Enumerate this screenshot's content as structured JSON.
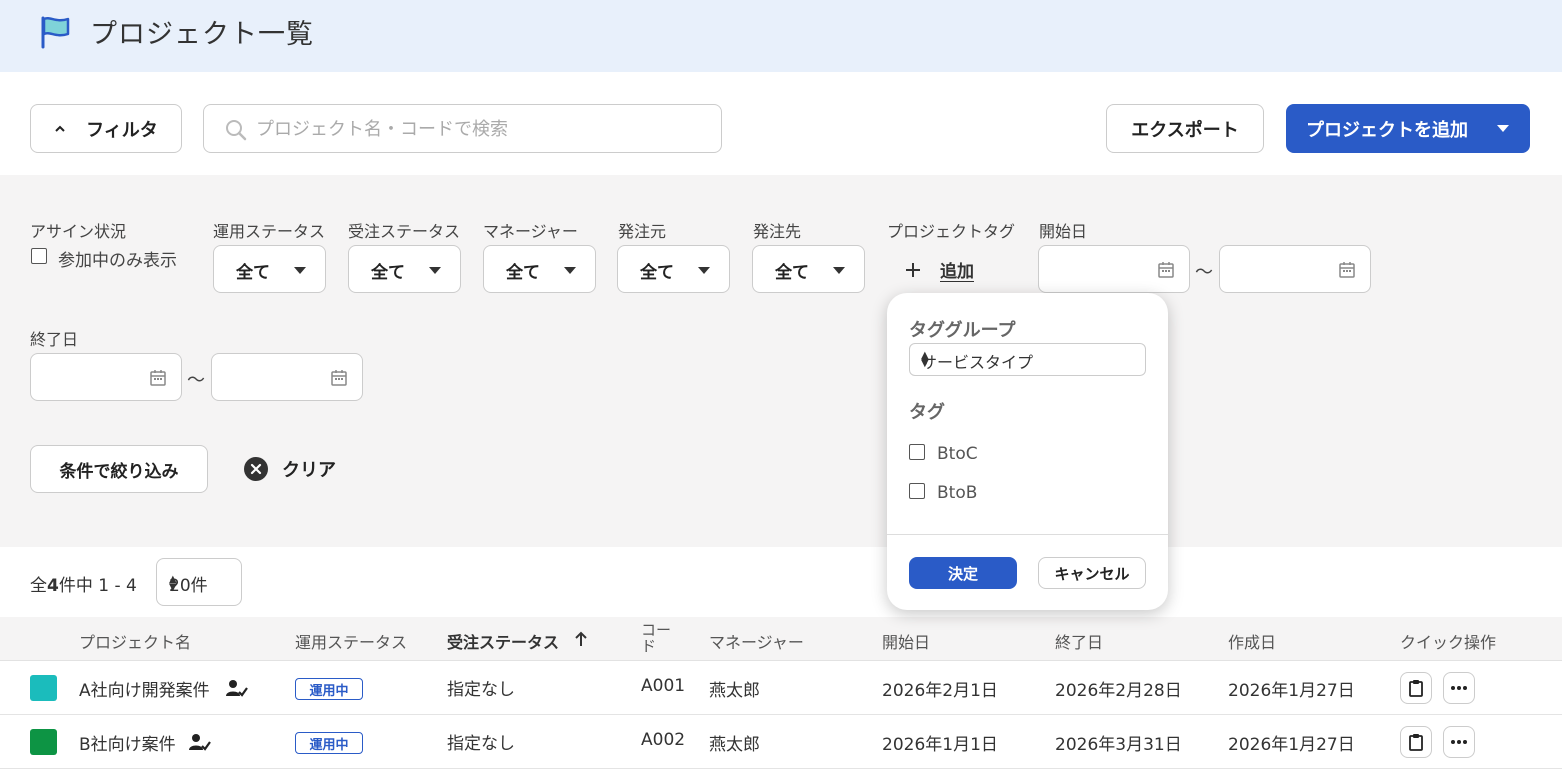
{
  "header": {
    "title": "プロジェクト一覧"
  },
  "toolbar": {
    "filter_label": "フィルタ",
    "search_placeholder": "プロジェクト名・コードで検索",
    "export_label": "エクスポート",
    "add_project_label": "プロジェクトを追加"
  },
  "filters": {
    "assign_label": "アサイン状況",
    "assign_checkbox_label": "参加中のみ表示",
    "operation_status_label": "運用ステータス",
    "operation_status_value": "全て",
    "order_status_label": "受注ステータス",
    "order_status_value": "全て",
    "manager_label": "マネージャー",
    "manager_value": "全て",
    "client_label": "発注元",
    "client_value": "全て",
    "vendor_label": "発注先",
    "vendor_value": "全て",
    "project_tag_label": "プロジェクトタグ",
    "add_tag_label": "追加",
    "start_date_label": "開始日",
    "end_date_label": "終了日",
    "tilde": "〜",
    "apply_label": "条件で絞り込み",
    "clear_label": "クリア"
  },
  "tag_popup": {
    "group_heading": "タググループ",
    "group_value": "サービスタイプ",
    "tag_heading": "タグ",
    "tags": [
      "BtoC",
      "BtoB"
    ],
    "ok_label": "決定",
    "cancel_label": "キャンセル"
  },
  "pagination": {
    "prefix": "全",
    "total": "4",
    "suffix": "件中 1 - 4",
    "per_page": "20件"
  },
  "table": {
    "columns": {
      "name": "プロジェクト名",
      "operation_status": "運用ステータス",
      "order_status": "受注ステータス",
      "code_line1": "コー",
      "code_line2": "ド",
      "manager": "マネージャー",
      "start": "開始日",
      "end": "終了日",
      "created": "作成日",
      "quick": "クイック操作"
    },
    "rows": [
      {
        "color": "#1bbcbc",
        "name": "A社向け開発案件",
        "operation_status": "運用中",
        "order_status": "指定なし",
        "code": "A001",
        "manager": "燕太郎",
        "start": "2026年2月1日",
        "end": "2026年2月28日",
        "created": "2026年1月27日"
      },
      {
        "color": "#0d9444",
        "name": "B社向け案件",
        "operation_status": "運用中",
        "order_status": "指定なし",
        "code": "A002",
        "manager": "燕太郎",
        "start": "2026年1月1日",
        "end": "2026年3月31日",
        "created": "2026年1月27日"
      }
    ]
  },
  "colors": {
    "accent": "#2a5bc7",
    "header_bg": "#e8f0fb",
    "panel_bg": "#f5f4f4"
  }
}
